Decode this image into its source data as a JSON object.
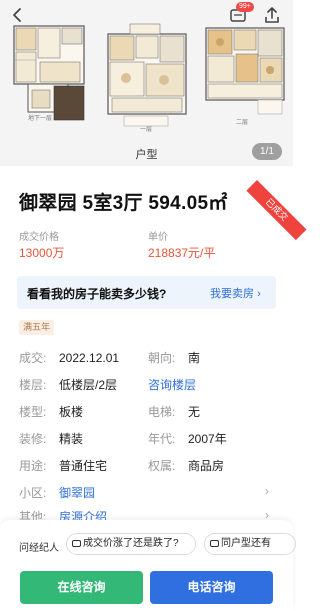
{
  "header": {
    "message_badge": "99+"
  },
  "gallery": {
    "plan_labels": [
      "地下一层",
      "一层",
      "二层"
    ],
    "caption": "户型",
    "counter": "1/1"
  },
  "listing": {
    "title": "御翠园 5室3厅 594.05㎡",
    "status": "已成交",
    "deal_price_label": "成交价格",
    "deal_price": "13000万",
    "unit_price_label": "单价",
    "unit_price": "218837元/平"
  },
  "banner": {
    "question": "看看我的房子能卖多少钱?",
    "link": "我要卖房"
  },
  "tag": "满五年",
  "info": {
    "deal_label": "成交:",
    "deal_value": "2022.12.01",
    "orientation_label": "朝向:",
    "orientation_value": "南",
    "floor_label": "楼层:",
    "floor_value": "低楼层/2层",
    "floor_link": "咨询楼层",
    "building_label": "楼型:",
    "building_value": "板楼",
    "elevator_label": "电梯:",
    "elevator_value": "无",
    "decor_label": "装修:",
    "decor_value": "精装",
    "year_label": "年代:",
    "year_value": "2007年",
    "usage_label": "用途:",
    "usage_value": "普通住宅",
    "ownership_label": "权属:",
    "ownership_value": "商品房",
    "community_label": "小区:",
    "community_value": "御翠园",
    "other_label": "其他:",
    "other_value": "房源介绍"
  },
  "bottom": {
    "ask_label": "问经纪人",
    "chip1": "成交价涨了还是跌了?",
    "chip2": "同户型还有",
    "online_button": "在线咨询",
    "phone_button": "电话咨询"
  },
  "colors": {
    "price_red": "#e8543c",
    "link_blue": "#2f6fd6",
    "online_green": "#34b878",
    "phone_blue": "#2f6fe0",
    "sold_red": "#f0433e"
  }
}
